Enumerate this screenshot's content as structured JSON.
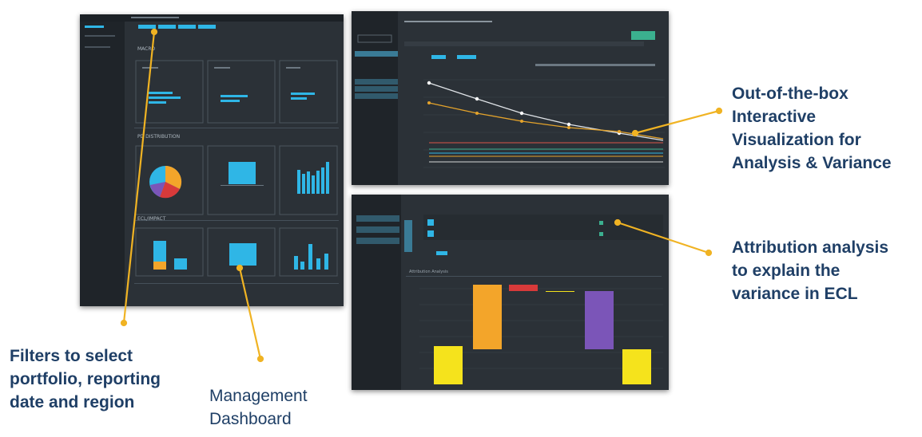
{
  "captions": {
    "interactive": [
      "Out-of-the-box",
      "Interactive",
      "Visualization for",
      "Analysis & Variance"
    ],
    "attribution": [
      "Attribution analysis",
      "to explain the",
      "variance in ECL"
    ],
    "filters": [
      "Filters to select",
      "portfolio, reporting",
      "date and region"
    ],
    "management": [
      "Management",
      "Dashboard"
    ]
  },
  "dashboard": {
    "sections": [
      "MACRO",
      "PD DISTRIBUTION",
      "ECL/IMPACT"
    ]
  },
  "attribution_panel": {
    "title": "Attribution Analysis"
  },
  "colors": {
    "panel_bg": "#2b3137",
    "sidebar_bg": "#1f2429",
    "accent_cyan": "#2fb6e6",
    "leader_gold": "#f0b323",
    "caption_blue": "#1f3f66",
    "bar_yellow": "#f5e31c",
    "bar_orange": "#f3a52a",
    "bar_red": "#d83a3a",
    "bar_purple": "#7b55b8"
  }
}
